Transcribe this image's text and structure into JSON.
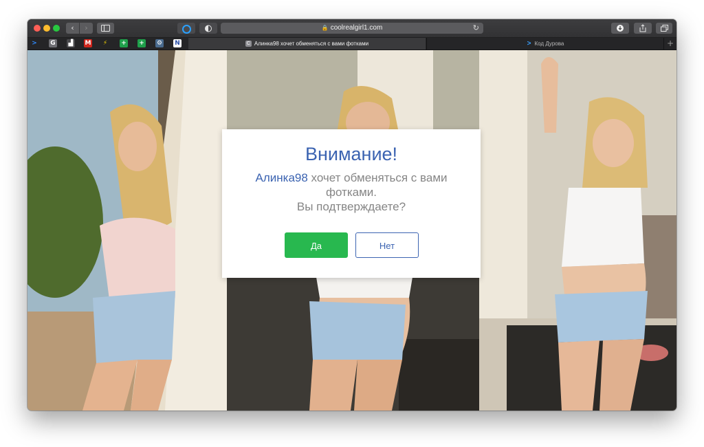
{
  "browser": {
    "url": "coolrealgirl1.com",
    "toolbar_icons": [
      "back-chevron-icon",
      "forward-chevron-icon",
      "sidebar-icon",
      "extension-ring-icon",
      "privacy-shield-icon",
      "download-icon",
      "share-icon",
      "tabs-overview-icon",
      "reload-icon",
      "lock-icon"
    ],
    "bookmarks": [
      {
        "name": "chevron-bookmark",
        "glyph": ">",
        "color": "#2f8cff",
        "bg": "transparent"
      },
      {
        "name": "g-bookmark",
        "glyph": "G",
        "color": "#ffffff",
        "bg": "#6e6e73"
      },
      {
        "name": "stats-bookmark",
        "glyph": "▟",
        "color": "#ffffff",
        "bg": "#4a4a4d"
      },
      {
        "name": "mail-bookmark",
        "glyph": "M",
        "color": "#ffffff",
        "bg": "#d0271d"
      },
      {
        "name": "bolt-bookmark",
        "glyph": "⚡",
        "color": "#f5d400",
        "bg": "transparent"
      },
      {
        "name": "plus-bookmark-1",
        "glyph": "+",
        "color": "#ffffff",
        "bg": "#1fa04b"
      },
      {
        "name": "plus-bookmark-2",
        "glyph": "+",
        "color": "#ffffff",
        "bg": "#1fa04b"
      },
      {
        "name": "gear-bookmark",
        "glyph": "⚙",
        "color": "#ffffff",
        "bg": "#4a6b8f"
      },
      {
        "name": "n-bookmark",
        "glyph": "N",
        "color": "#2a4fa8",
        "bg": "#ffffff"
      }
    ],
    "tabs": [
      {
        "label": "Алинка98 хочет обменяться с вами фотками",
        "favicon": "C",
        "active": true
      },
      {
        "label": "Код Дурова",
        "favicon": ">",
        "active": false
      }
    ],
    "new_tab": "+"
  },
  "modal": {
    "title": "Внимание!",
    "user": "Алинка98",
    "message_rest": " хочет обменяться с вами фотками.",
    "question": "Вы подтверждаете?",
    "yes_label": "Да",
    "no_label": "Нет"
  },
  "colors": {
    "accent_blue": "#3b63b1",
    "yes_green": "#28b84f",
    "message_gray": "#858585"
  }
}
